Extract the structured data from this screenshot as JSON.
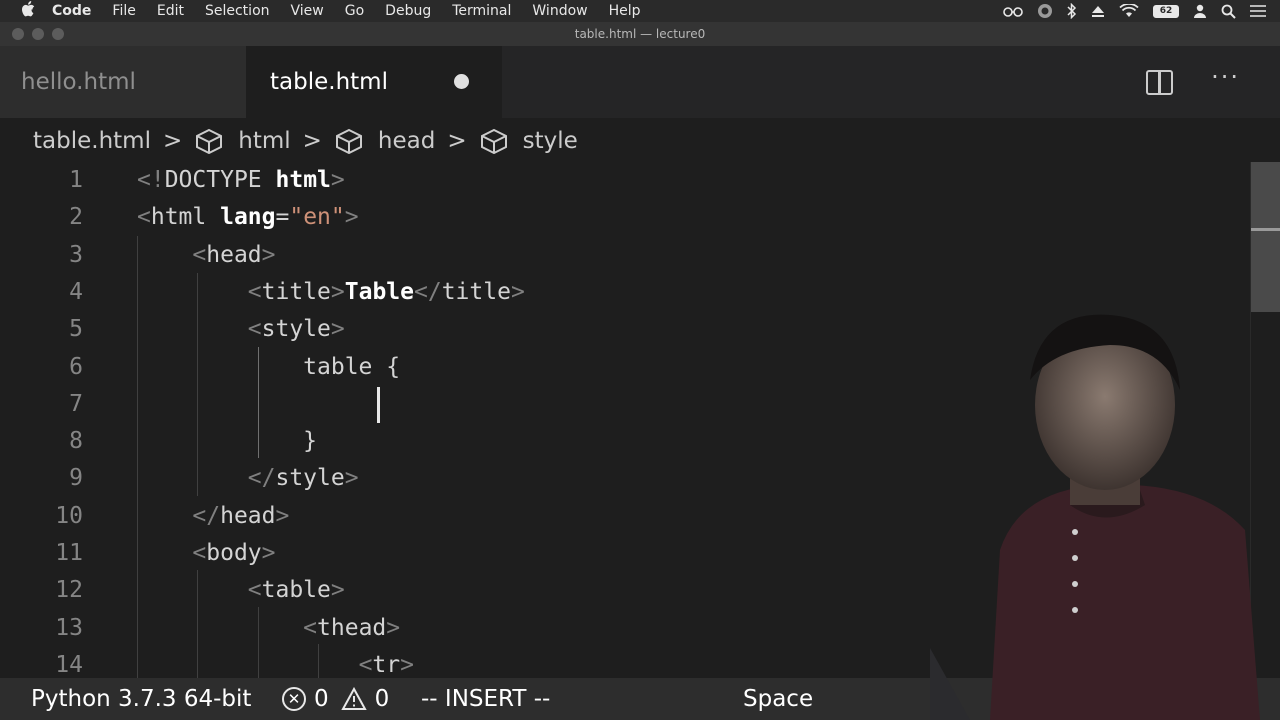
{
  "menubar": {
    "items": [
      "Code",
      "File",
      "Edit",
      "Selection",
      "View",
      "Go",
      "Debug",
      "Terminal",
      "Window",
      "Help"
    ],
    "status_icons": [
      "glasses-icon",
      "circle-icon",
      "bluetooth-icon",
      "eject-icon",
      "wifi-icon",
      "battery-icon",
      "user-icon",
      "search-icon",
      "list-icon"
    ],
    "battery_label": "62"
  },
  "window": {
    "title": "table.html — lecture0"
  },
  "tabs": [
    {
      "label": "hello.html",
      "active": false
    },
    {
      "label": "table.html",
      "active": true,
      "dirty": true
    }
  ],
  "breadcrumb": [
    "table.html",
    "html",
    "head",
    "style"
  ],
  "editor": {
    "lines": [
      {
        "n": "1",
        "tokens": [
          [
            "b",
            "<!"
          ],
          [
            "t",
            "DOCTYPE"
          ],
          [
            "t",
            " "
          ],
          [
            "k",
            "html"
          ],
          [
            "b",
            ">"
          ]
        ]
      },
      {
        "n": "2",
        "tokens": [
          [
            "b",
            "<"
          ],
          [
            "t",
            "html"
          ],
          [
            "t",
            " "
          ],
          [
            "k",
            "lang"
          ],
          [
            "t",
            "="
          ],
          [
            "s",
            "\"en\""
          ],
          [
            "b",
            ">"
          ]
        ]
      },
      {
        "n": "3",
        "tokens": [
          [
            "t",
            "    "
          ],
          [
            "b",
            "<"
          ],
          [
            "t",
            "head"
          ],
          [
            "b",
            ">"
          ]
        ]
      },
      {
        "n": "4",
        "tokens": [
          [
            "t",
            "        "
          ],
          [
            "b",
            "<"
          ],
          [
            "t",
            "title"
          ],
          [
            "b",
            ">"
          ],
          [
            "k",
            "Table"
          ],
          [
            "b",
            "</"
          ],
          [
            "t",
            "title"
          ],
          [
            "b",
            ">"
          ]
        ]
      },
      {
        "n": "5",
        "tokens": [
          [
            "t",
            "        "
          ],
          [
            "b",
            "<"
          ],
          [
            "t",
            "style"
          ],
          [
            "b",
            ">"
          ]
        ]
      },
      {
        "n": "6",
        "tokens": [
          [
            "t",
            "            table {"
          ]
        ]
      },
      {
        "n": "7",
        "tokens": []
      },
      {
        "n": "8",
        "tokens": [
          [
            "t",
            "            }"
          ]
        ]
      },
      {
        "n": "9",
        "tokens": [
          [
            "t",
            "        "
          ],
          [
            "b",
            "</"
          ],
          [
            "t",
            "style"
          ],
          [
            "b",
            ">"
          ]
        ]
      },
      {
        "n": "10",
        "tokens": [
          [
            "t",
            "    "
          ],
          [
            "b",
            "</"
          ],
          [
            "t",
            "head"
          ],
          [
            "b",
            ">"
          ]
        ]
      },
      {
        "n": "11",
        "tokens": [
          [
            "t",
            "    "
          ],
          [
            "b",
            "<"
          ],
          [
            "t",
            "body"
          ],
          [
            "b",
            ">"
          ]
        ]
      },
      {
        "n": "12",
        "tokens": [
          [
            "t",
            "        "
          ],
          [
            "b",
            "<"
          ],
          [
            "t",
            "table"
          ],
          [
            "b",
            ">"
          ]
        ]
      },
      {
        "n": "13",
        "tokens": [
          [
            "t",
            "            "
          ],
          [
            "b",
            "<"
          ],
          [
            "t",
            "thead"
          ],
          [
            "b",
            ">"
          ]
        ]
      },
      {
        "n": "14",
        "tokens": [
          [
            "t",
            "                "
          ],
          [
            "b",
            "<"
          ],
          [
            "t",
            "tr"
          ],
          [
            "b",
            ">"
          ]
        ]
      }
    ]
  },
  "statusbar": {
    "python": "Python 3.7.3 64-bit",
    "errors": "0",
    "warnings": "0",
    "mode": "-- INSERT --",
    "spaces": "Space"
  },
  "colors": {
    "editor_bg": "#1e1e1e",
    "tab_active": "#1e1e1e",
    "tab_inactive": "#2d2d2d",
    "string": "#ce9178"
  }
}
